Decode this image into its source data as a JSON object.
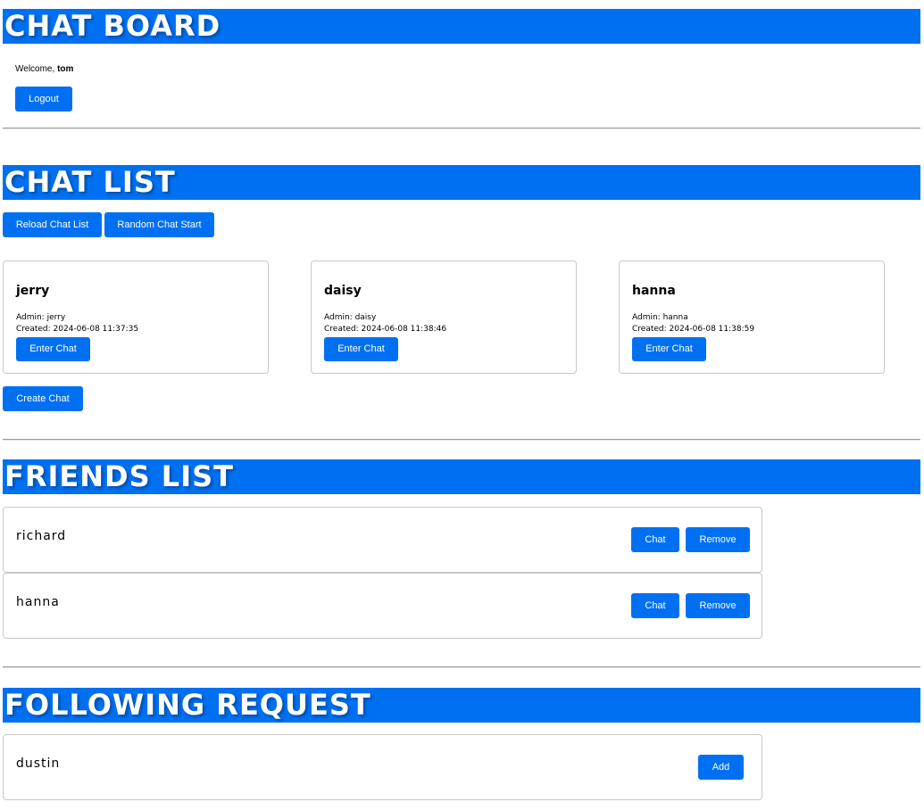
{
  "header": {
    "title": "CHAT BOARD",
    "welcome_prefix": "Welcome, ",
    "username": "tom",
    "logout_label": "Logout"
  },
  "chat_list": {
    "title": "CHAT LIST",
    "reload_label": "Reload Chat List",
    "random_label": "Random Chat Start",
    "create_label": "Create Chat",
    "chats": [
      {
        "name": "jerry",
        "admin": "Admin: jerry",
        "created": "Created: 2024-06-08 11:37:35",
        "enter_label": "Enter Chat"
      },
      {
        "name": "daisy",
        "admin": "Admin: daisy",
        "created": "Created: 2024-06-08 11:38:46",
        "enter_label": "Enter Chat"
      },
      {
        "name": "hanna",
        "admin": "Admin: hanna",
        "created": "Created: 2024-06-08 11:38:59",
        "enter_label": "Enter Chat"
      }
    ]
  },
  "friends_list": {
    "title": "FRIENDS LIST",
    "friends": [
      {
        "name": "richard",
        "chat_label": "Chat",
        "remove_label": "Remove"
      },
      {
        "name": "hanna",
        "chat_label": "Chat",
        "remove_label": "Remove"
      }
    ]
  },
  "following_request": {
    "title": "FOLLOWING REQUEST",
    "requests": [
      {
        "name": "dustin",
        "add_label": "Add"
      }
    ]
  },
  "colors": {
    "accent": "#0070f3",
    "border": "#c8c8c8"
  }
}
